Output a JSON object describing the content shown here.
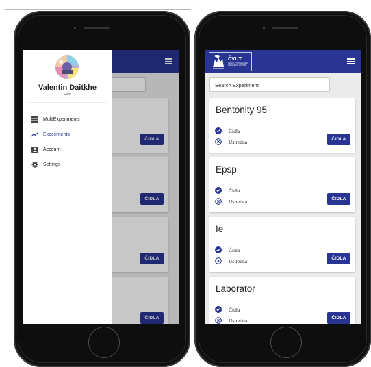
{
  "colors": {
    "primary": "#283593",
    "check": "#283593",
    "screen_bg": "#ebebeb",
    "text": "#222222"
  },
  "left_phone": {
    "drawer": {
      "user_name": "Valentin Daitkhe",
      "user_role": "User",
      "items": [
        {
          "label": "MultiExperiments",
          "icon": "list-icon"
        },
        {
          "label": "Experiments",
          "icon": "trending-icon",
          "active": true
        },
        {
          "label": "Account",
          "icon": "account-box-icon"
        },
        {
          "label": "Settings",
          "icon": "gear-icon"
        }
      ]
    },
    "cards": [
      {
        "button": "ČIDLA"
      },
      {
        "button": "ČIDLA"
      },
      {
        "button": "ČIDLA"
      },
      {
        "button": "ČIDLA"
      }
    ]
  },
  "right_phone": {
    "header": {
      "logo_title": "ČVUT",
      "logo_subtitle": "ČESKÉ VYSOKÉ UČENÍ TECHNICKÉ V PRAZE",
      "menu_icon": "hamburger-icon"
    },
    "search": {
      "placeholder": "Search Experiment"
    },
    "experiments": [
      {
        "title": "Bentonity 95",
        "rows": [
          {
            "label": "Čidla",
            "status": "check-circle-icon"
          },
          {
            "label": "Ustredna",
            "status": "x-circle-icon"
          }
        ],
        "button": "ČIDLA"
      },
      {
        "title": "Epsp",
        "rows": [
          {
            "label": "Čidla",
            "status": "check-circle-icon"
          },
          {
            "label": "Ustredna",
            "status": "x-circle-icon"
          }
        ],
        "button": "ČIDLA"
      },
      {
        "title": "Ie",
        "rows": [
          {
            "label": "Čidla",
            "status": "check-circle-icon"
          },
          {
            "label": "Ustredna",
            "status": "x-circle-icon"
          }
        ],
        "button": "ČIDLA"
      },
      {
        "title": "Laborator",
        "rows": [
          {
            "label": "Čidla",
            "status": "check-circle-icon"
          },
          {
            "label": "Ustredna",
            "status": "x-circle-icon"
          }
        ],
        "button": "ČIDLA"
      }
    ]
  }
}
